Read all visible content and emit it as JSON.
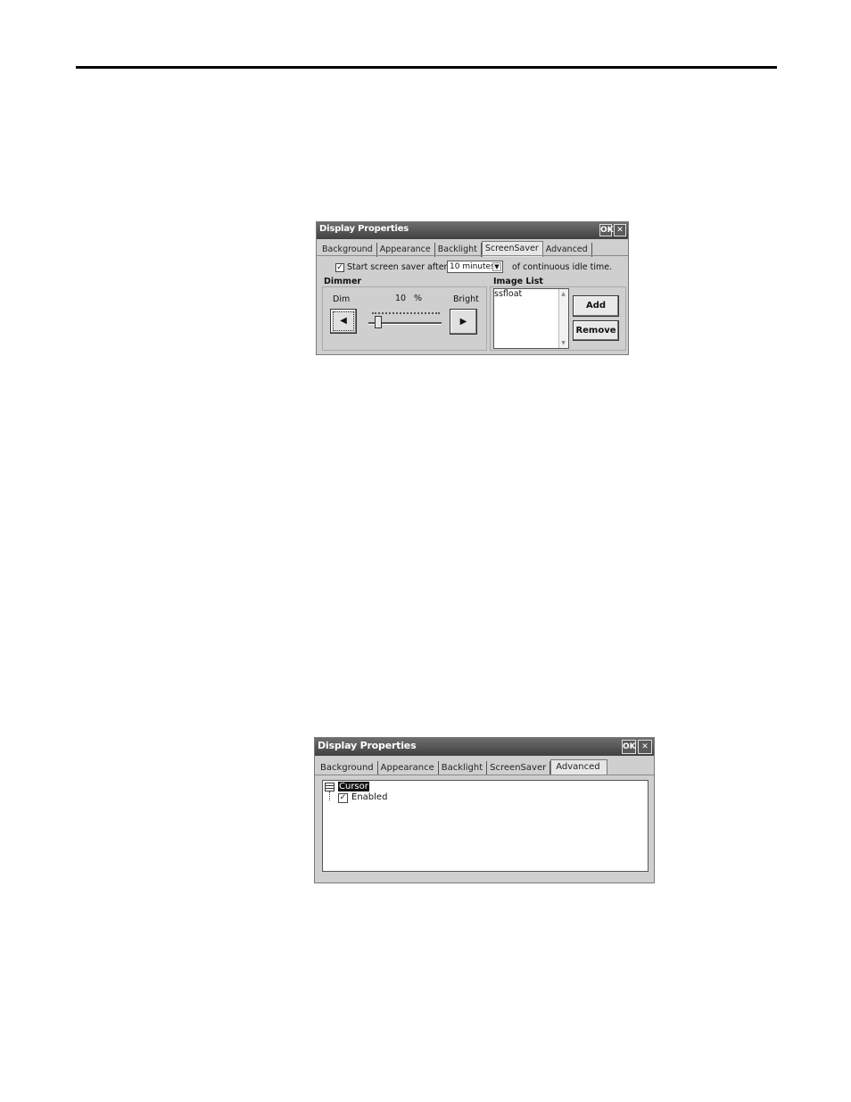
{
  "dialog1": {
    "title": "Display Properties",
    "ok_label": "OK",
    "close_label": "✕",
    "tabs": [
      "Background",
      "Appearance",
      "Backlight",
      "ScreenSaver",
      "Advanced"
    ],
    "active_tab": "ScreenSaver",
    "screensaver": {
      "start_label": "Start screen saver after",
      "checked": true,
      "idle_value": "10 minutes",
      "idle_suffix": "of continuous idle time."
    },
    "dimmer": {
      "heading": "Dimmer",
      "dim_label": "Dim",
      "bright_label": "Bright",
      "percent_value": "10",
      "percent_unit": "%",
      "level": 0.1,
      "left_arrow": "◀",
      "right_arrow": "▶"
    },
    "image_list": {
      "heading": "Image List",
      "items": [
        "ssfloat"
      ],
      "add_label": "Add",
      "remove_label": "Remove"
    }
  },
  "dialog2": {
    "title": "Display Properties",
    "ok_label": "OK",
    "close_label": "✕",
    "tabs": [
      "Background",
      "Appearance",
      "Backlight",
      "ScreenSaver",
      "Advanced"
    ],
    "active_tab": "Advanced",
    "tree": {
      "node_label": "Cursor",
      "child_label": "Enabled",
      "child_checked": true
    }
  }
}
